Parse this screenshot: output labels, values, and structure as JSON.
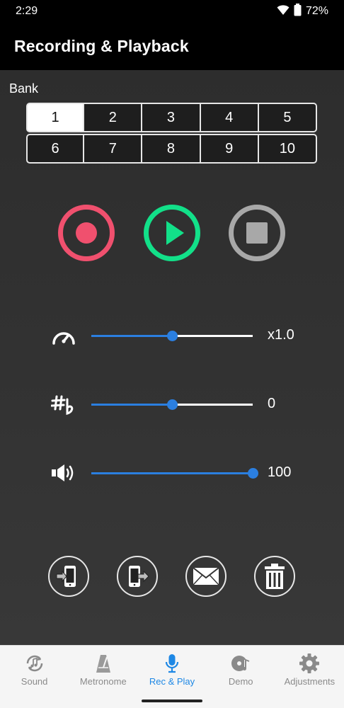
{
  "status": {
    "time": "2:29",
    "battery": "72%"
  },
  "app": {
    "title": "Recording & Playback"
  },
  "bank": {
    "label": "Bank",
    "selected": "1",
    "row1": [
      "1",
      "2",
      "3",
      "4",
      "5"
    ],
    "row2": [
      "6",
      "7",
      "8",
      "9",
      "10"
    ]
  },
  "transport": {
    "record": "record-icon",
    "play": "play-icon",
    "stop": "stop-icon",
    "colors": {
      "record": "#f0506e",
      "play": "#12e089",
      "stop": "#a8a8a8"
    }
  },
  "sliders": {
    "tempo": {
      "icon": "speedometer-icon",
      "value_text": "x1.0",
      "level": 0.5
    },
    "transpose": {
      "icon": "sharp-flat-icon",
      "value_text": "0",
      "level": 0.5
    },
    "volume": {
      "icon": "speaker-icon",
      "value_text": "100",
      "level": 1.0
    }
  },
  "actions": [
    "import-icon",
    "export-icon",
    "mail-icon",
    "trash-icon"
  ],
  "nav": {
    "items": [
      {
        "label": "Sound",
        "icon": "sound-icon"
      },
      {
        "label": "Metronome",
        "icon": "metronome-icon"
      },
      {
        "label": "Rec & Play",
        "icon": "microphone-icon"
      },
      {
        "label": "Demo",
        "icon": "demo-disc-icon"
      },
      {
        "label": "Adjustments",
        "icon": "gear-icon"
      }
    ],
    "active": "Rec & Play",
    "accent": "#1e88e5"
  },
  "colors": {
    "slider_accent": "#2b7fe0"
  }
}
